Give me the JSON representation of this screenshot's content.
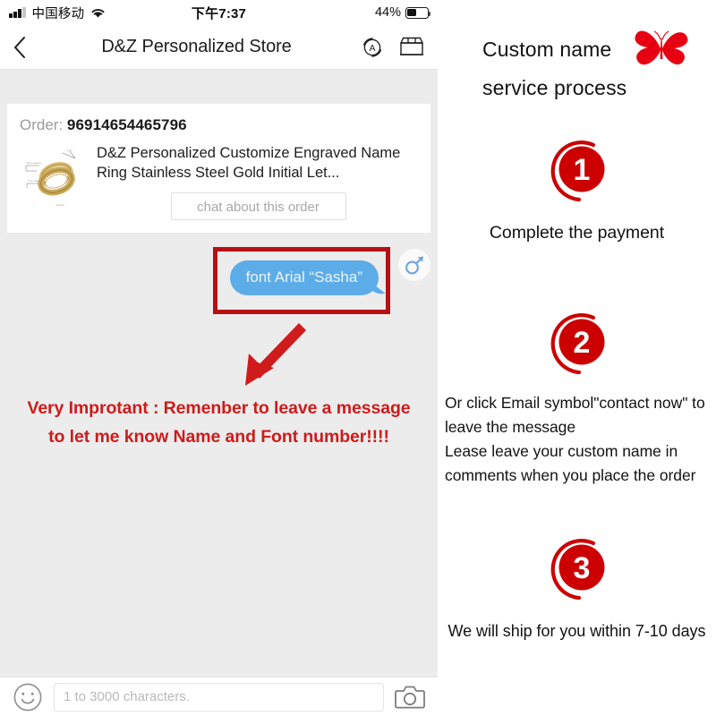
{
  "phone": {
    "status_bar": {
      "carrier": "中国移动",
      "time": "下午7:37",
      "battery_percent": "44%",
      "battery_level": 44,
      "signal_bars": 3,
      "wifi_icon": "wifi-icon"
    },
    "nav": {
      "back_icon": "chevron-left-icon",
      "title": "D&Z Personalized Store",
      "translate_icon": "auto-translate-icon",
      "store_icon": "storefront-icon"
    },
    "order_card": {
      "label": "Order:",
      "order_number": "96914654465796",
      "thumbnail_alt": "gold-ring-product-image",
      "product_title": "D&Z Personalized Customize Engraved Name Ring Stainless Steel Gold Initial Let...",
      "chat_button": "chat about this order"
    },
    "message": {
      "bubble_text": "font Arial “Sasha”",
      "bubble_color": "#5cace8",
      "avatar_icon": "male-symbol-avatar",
      "highlight_color": "#b80f12"
    },
    "annotation": {
      "arrow_icon": "down-left-arrow-icon",
      "arrow_color": "#cf1b1b",
      "warning_line1": "Very Improtant : Remenber to leave a message",
      "warning_line2": "to let me know Name and Font number!!!!",
      "warning_color": "#cf1b1b"
    },
    "input_bar": {
      "emoji_icon": "smiley-face-icon",
      "placeholder": "1 to 3000 characters.",
      "value": "",
      "camera_icon": "camera-icon"
    }
  },
  "info_panel": {
    "heading_line1": "Custom name",
    "heading_line2": "service process",
    "butterfly_icon": "butterfly-icon",
    "accent_color": "#cc0000",
    "steps": [
      {
        "number": "1",
        "align": "center",
        "lines": [
          "Complete the payment"
        ]
      },
      {
        "number": "2",
        "align": "left",
        "lines": [
          "Or click Email symbol\"contact now\" to",
          "leave the message",
          "Lease leave your custom name in",
          "comments when you place the order"
        ]
      },
      {
        "number": "3",
        "align": "center",
        "lines": [
          "We will ship for you within 7-10 days"
        ]
      }
    ]
  }
}
